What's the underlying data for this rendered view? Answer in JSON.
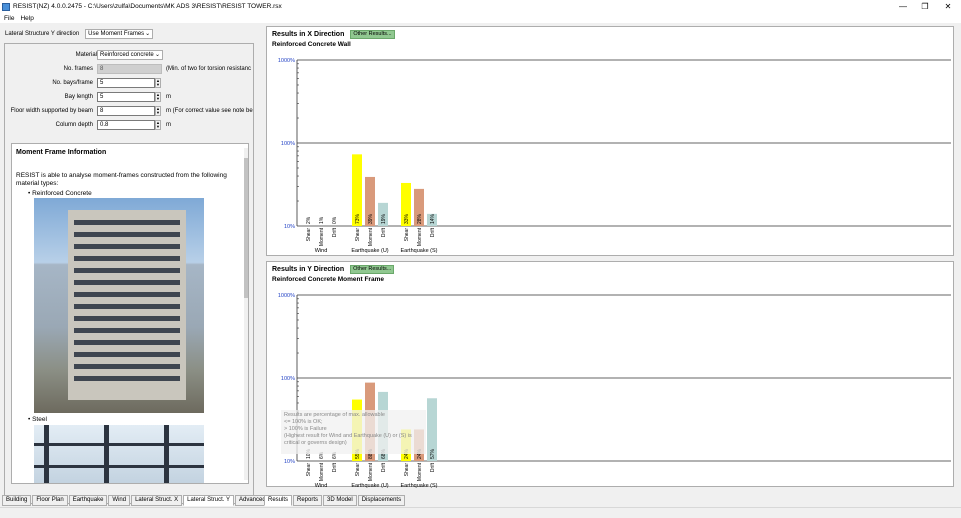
{
  "window": {
    "title": "RESIST(NZ) 4.0.0.2475 - C:\\Users\\zulfa\\Documents\\MK ADS 3\\RESIST\\RESIST TOWER.rsx",
    "minimize": "—",
    "maximize": "❐",
    "close": "✕"
  },
  "menu": [
    "File",
    "Help"
  ],
  "left": {
    "lateral_label": "Lateral Structure Y direction",
    "lateral_value": "Use Moment Frames",
    "material_label": "Material",
    "material_value": "Reinforced concrete",
    "fields": [
      {
        "label": "No. frames",
        "value": "8",
        "unit": "(Min. of two for torsion resistanc",
        "disabled": true
      },
      {
        "label": "No. bays/frame",
        "value": "5",
        "unit": "",
        "disabled": false
      },
      {
        "label": "Bay length",
        "value": "5",
        "unit": "m",
        "disabled": false
      },
      {
        "label": "Floor width supported by beam",
        "value": "8",
        "unit": "m (For correct value see note be",
        "disabled": false
      },
      {
        "label": "Column depth",
        "value": "0.8",
        "unit": "m",
        "disabled": false
      }
    ],
    "info_title": "Moment Frame Information",
    "info_text": "RESIST is able to analyse moment-frames constructed from the following material types:",
    "bullet1": "Reinforced Concrete",
    "bullet2": "Steel"
  },
  "left_tabs": [
    "Building",
    "Floor Plan",
    "Earthquake",
    "Wind",
    "Lateral Struct. X",
    "Lateral Struct. Y",
    "Advanced"
  ],
  "left_tab_active": 5,
  "right_tabs": [
    "Results",
    "Reports",
    "3D Model",
    "Displacements"
  ],
  "right_tab_active": 0,
  "results_x": {
    "title": "Results in X Direction",
    "other_button": "Other Results...",
    "subtitle": "Reinforced Concrete Wall"
  },
  "results_y": {
    "title": "Results in Y Direction",
    "other_button": "Other Results...",
    "subtitle": "Reinforced Concrete Moment Frame",
    "tooltip": [
      "Results are percentage of max. allowable",
      "  <= 100% is OK;",
      "  > 100% is Failure",
      "  (Highest result for Wind and Earthquake (U) or (S) is",
      "  critical or governs design)"
    ]
  },
  "colors": {
    "shear": "#ffff00",
    "moment": "#d99a7b",
    "drift": "#b7d6d4",
    "axis_label": "#1f3fc4"
  },
  "chart_data": [
    {
      "type": "bar",
      "yscale": "log",
      "ylim": [
        10,
        1000
      ],
      "yticks": [
        "1000%",
        "100%",
        "10%"
      ],
      "groups": [
        "Wind",
        "Earthquake (U)",
        "Earthquake (S)"
      ],
      "bars": [
        {
          "group": "Wind",
          "metric": "Shear",
          "value": 2,
          "label": "2%"
        },
        {
          "group": "Wind",
          "metric": "Moment",
          "value": 1,
          "label": "1%"
        },
        {
          "group": "Wind",
          "metric": "Drift",
          "value": 0,
          "label": "0%"
        },
        {
          "group": "Earthquake (U)",
          "metric": "Shear",
          "value": 73,
          "label": "73%"
        },
        {
          "group": "Earthquake (U)",
          "metric": "Moment",
          "value": 39,
          "label": "39%"
        },
        {
          "group": "Earthquake (U)",
          "metric": "Drift",
          "value": 19,
          "label": "19%"
        },
        {
          "group": "Earthquake (S)",
          "metric": "Shear",
          "value": 33,
          "label": "33%"
        },
        {
          "group": "Earthquake (S)",
          "metric": "Moment",
          "value": 28,
          "label": "28%"
        },
        {
          "group": "Earthquake (S)",
          "metric": "Drift",
          "value": 14,
          "label": "14%"
        }
      ]
    },
    {
      "type": "bar",
      "yscale": "log",
      "ylim": [
        10,
        1000
      ],
      "yticks": [
        "1000%",
        "100%",
        "10%"
      ],
      "groups": [
        "Wind",
        "Earthquake (U)",
        "Earthquake (S)"
      ],
      "bars": [
        {
          "group": "Wind",
          "metric": "Shear",
          "value": 10,
          "label": "10%"
        },
        {
          "group": "Wind",
          "metric": "Moment",
          "value": 6,
          "label": "6%"
        },
        {
          "group": "Wind",
          "metric": "Drift",
          "value": 6,
          "label": "6%"
        },
        {
          "group": "Earthquake (U)",
          "metric": "Shear",
          "value": 55,
          "label": "55%"
        },
        {
          "group": "Earthquake (U)",
          "metric": "Moment",
          "value": 88,
          "label": "88%"
        },
        {
          "group": "Earthquake (U)",
          "metric": "Drift",
          "value": 68,
          "label": "68%"
        },
        {
          "group": "Earthquake (S)",
          "metric": "Shear",
          "value": 24,
          "label": "24%"
        },
        {
          "group": "Earthquake (S)",
          "metric": "Moment",
          "value": 24,
          "label": "24%"
        },
        {
          "group": "Earthquake (S)",
          "metric": "Drift",
          "value": 57,
          "label": "57%"
        }
      ]
    }
  ]
}
